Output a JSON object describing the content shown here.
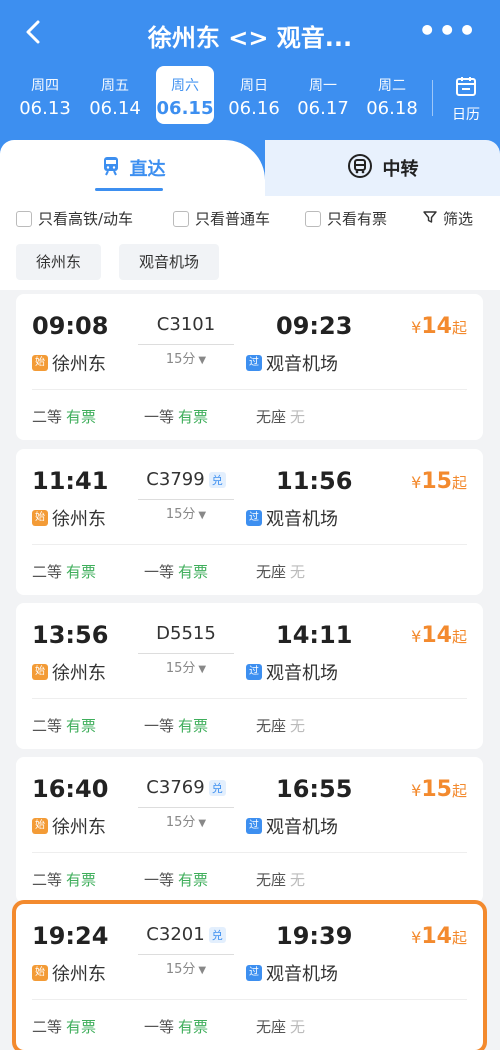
{
  "header": {
    "back_icon": "back-arrow-icon",
    "title": "徐州东 <> 观音...",
    "more_icon": "more-dots-icon",
    "color": "#3d8ff0"
  },
  "dates": [
    {
      "weekday": "周四",
      "date": "06.13",
      "active": false
    },
    {
      "weekday": "周五",
      "date": "06.14",
      "active": false
    },
    {
      "weekday": "周六",
      "date": "06.15",
      "active": true
    },
    {
      "weekday": "周日",
      "date": "06.16",
      "active": false
    },
    {
      "weekday": "周一",
      "date": "06.17",
      "active": false
    },
    {
      "weekday": "周二",
      "date": "06.18",
      "active": false
    }
  ],
  "calendar": {
    "label": "日历",
    "icon": "calendar-icon"
  },
  "tabs": {
    "direct": {
      "label": "直达",
      "icon": "train-icon",
      "active": true
    },
    "transfer": {
      "label": "中转",
      "icon": "bus-icon",
      "active": false
    }
  },
  "filters": [
    {
      "label": "只看高铁/动车",
      "checked": false
    },
    {
      "label": "只看普通车",
      "checked": false
    },
    {
      "label": "只看有票",
      "checked": false
    }
  ],
  "filter_button": {
    "label": "筛选",
    "icon": "filter-icon"
  },
  "station_chips": [
    "徐州东",
    "观音机场"
  ],
  "trains": [
    {
      "depart": "09:08",
      "train": "C3101",
      "tag": "",
      "arrive": "09:23",
      "duration": "15分",
      "from": "徐州东",
      "from_badge": "始",
      "to": "观音机场",
      "to_badge": "过",
      "price_symbol": "¥",
      "price": "14",
      "price_suffix": "起",
      "seats": [
        {
          "name": "二等",
          "status": "有票"
        },
        {
          "name": "一等",
          "status": "有票"
        },
        {
          "name": "无座",
          "status": "无"
        }
      ]
    },
    {
      "depart": "11:41",
      "train": "C3799",
      "tag": "兑",
      "arrive": "11:56",
      "duration": "15分",
      "from": "徐州东",
      "from_badge": "始",
      "to": "观音机场",
      "to_badge": "过",
      "price_symbol": "¥",
      "price": "15",
      "price_suffix": "起",
      "seats": [
        {
          "name": "二等",
          "status": "有票"
        },
        {
          "name": "一等",
          "status": "有票"
        },
        {
          "name": "无座",
          "status": "无"
        }
      ]
    },
    {
      "depart": "13:56",
      "train": "D5515",
      "tag": "",
      "arrive": "14:11",
      "duration": "15分",
      "from": "徐州东",
      "from_badge": "始",
      "to": "观音机场",
      "to_badge": "过",
      "price_symbol": "¥",
      "price": "14",
      "price_suffix": "起",
      "seats": [
        {
          "name": "二等",
          "status": "有票"
        },
        {
          "name": "一等",
          "status": "有票"
        },
        {
          "name": "无座",
          "status": "无"
        }
      ]
    },
    {
      "depart": "16:40",
      "train": "C3769",
      "tag": "兑",
      "arrive": "16:55",
      "duration": "15分",
      "from": "徐州东",
      "from_badge": "始",
      "to": "观音机场",
      "to_badge": "过",
      "price_symbol": "¥",
      "price": "15",
      "price_suffix": "起",
      "seats": [
        {
          "name": "二等",
          "status": "有票"
        },
        {
          "name": "一等",
          "status": "有票"
        },
        {
          "name": "无座",
          "status": "无"
        }
      ]
    },
    {
      "depart": "19:24",
      "train": "C3201",
      "tag": "兑",
      "arrive": "19:39",
      "duration": "15分",
      "from": "徐州东",
      "from_badge": "始",
      "to": "观音机场",
      "to_badge": "过",
      "price_symbol": "¥",
      "price": "14",
      "price_suffix": "起",
      "highlighted": true,
      "seats": [
        {
          "name": "二等",
          "status": "有票"
        },
        {
          "name": "一等",
          "status": "有票"
        },
        {
          "name": "无座",
          "status": "无"
        }
      ]
    }
  ],
  "colors": {
    "available": "#3fae5b",
    "unavailable": "#bbbbbb",
    "price": "#f38a2e",
    "highlight": "#f38a2e"
  }
}
